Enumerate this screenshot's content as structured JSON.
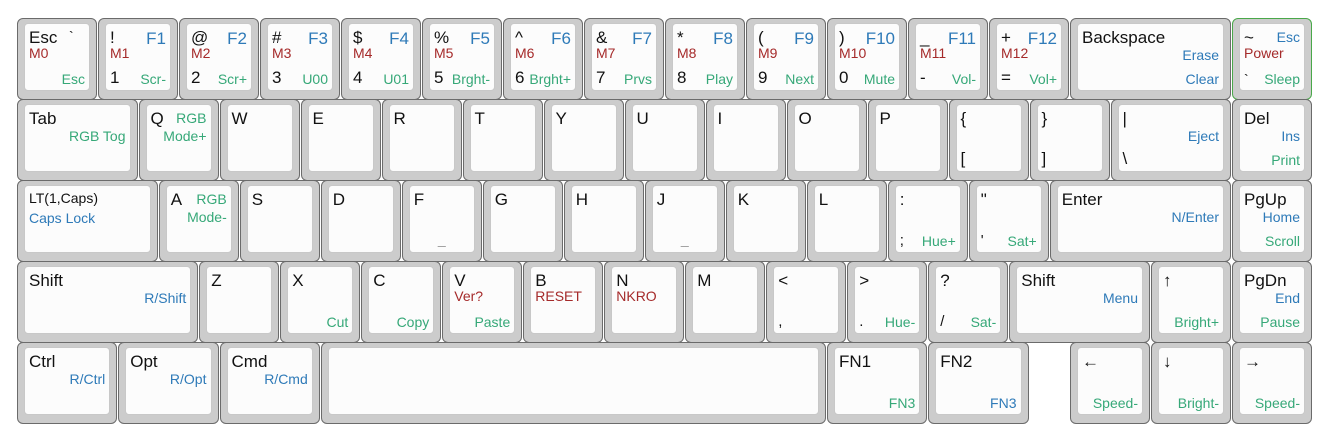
{
  "colors": {
    "background": "#ffffff",
    "key_frame": "#cccccc",
    "key_top": "#fcfcfc",
    "key_border": "#6b6b6b",
    "accent_border": "#4aa84a",
    "black": "#111111",
    "blue": "#2e7ab8",
    "red": "#a52a2a",
    "green": "#36a878"
  },
  "keys": {
    "esc": {
      "tl": "Esc",
      "tl_b": "`",
      "m": "M0",
      "br": "Esc"
    },
    "k1": {
      "tl": "!",
      "tr": "F1",
      "m": "M1",
      "bl": "1",
      "br": "Scr-"
    },
    "k2": {
      "tl": "@",
      "tr": "F2",
      "m": "M2",
      "bl": "2",
      "br": "Scr+"
    },
    "k3": {
      "tl": "#",
      "tr": "F3",
      "m": "M3",
      "bl": "3",
      "br": "U00"
    },
    "k4": {
      "tl": "$",
      "tr": "F4",
      "m": "M4",
      "bl": "4",
      "br": "U01"
    },
    "k5": {
      "tl": "%",
      "tr": "F5",
      "m": "M5",
      "bl": "5",
      "br": "Brght-"
    },
    "k6": {
      "tl": "^",
      "tr": "F6",
      "m": "M6",
      "bl": "6",
      "br": "Brght+"
    },
    "k7": {
      "tl": "&",
      "tr": "F7",
      "m": "M7",
      "bl": "7",
      "br": "Prvs"
    },
    "k8": {
      "tl": "*",
      "tr": "F8",
      "m": "M8",
      "bl": "8",
      "br": "Play"
    },
    "k9": {
      "tl": "(",
      "tr": "F9",
      "m": "M9",
      "bl": "9",
      "br": "Next"
    },
    "k0": {
      "tl": ")",
      "tr": "F10",
      "m": "M10",
      "bl": "0",
      "br": "Mute"
    },
    "minus": {
      "tl": "_",
      "tr": "F11",
      "m": "M11",
      "bl": "-",
      "br": "Vol-"
    },
    "equal": {
      "tl": "+",
      "tr": "F12",
      "m": "M12",
      "bl": "=",
      "br": "Vol+"
    },
    "backspace": {
      "tl": "Backspace",
      "mr": "Erase",
      "br": "Clear"
    },
    "tilde": {
      "tl": "~",
      "tr": "Esc",
      "m": "Power",
      "bl": "`",
      "br": "Sleep"
    },
    "tab": {
      "tl": "Tab",
      "mr": "RGB Tog"
    },
    "q": {
      "tl": "Q",
      "tr": "RGB",
      "mr": "Mode+"
    },
    "w": {
      "tl": "W"
    },
    "e": {
      "tl": "E"
    },
    "r": {
      "tl": "R"
    },
    "t": {
      "tl": "T"
    },
    "y": {
      "tl": "Y"
    },
    "u": {
      "tl": "U"
    },
    "i": {
      "tl": "I"
    },
    "o": {
      "tl": "O"
    },
    "p": {
      "tl": "P"
    },
    "lbracket": {
      "tl": "{",
      "bl": "["
    },
    "rbracket": {
      "tl": "}",
      "bl": "]"
    },
    "backslash": {
      "tl": "|",
      "mr": "Eject",
      "bl": "\\"
    },
    "del": {
      "tl": "Del",
      "mr": "Ins",
      "br": "Print"
    },
    "caps": {
      "tl": "LT(1,Caps)",
      "ml": "Caps Lock"
    },
    "a": {
      "tl": "A",
      "tr": "RGB",
      "mr": "Mode-"
    },
    "s": {
      "tl": "S"
    },
    "d": {
      "tl": "D"
    },
    "f": {
      "tl": "F",
      "bc": "_"
    },
    "g": {
      "tl": "G"
    },
    "h": {
      "tl": "H"
    },
    "j": {
      "tl": "J",
      "bc": "_"
    },
    "k": {
      "tl": "K"
    },
    "l": {
      "tl": "L"
    },
    "semicolon": {
      "tl": ":",
      "bl": ";",
      "br": "Hue+"
    },
    "quote": {
      "tl": "\"",
      "bl": "'",
      "br": "Sat+"
    },
    "enter": {
      "tl": "Enter",
      "mr": "N/Enter"
    },
    "pgup": {
      "tl": "PgUp",
      "mr": "Home",
      "br": "Scroll"
    },
    "lshift": {
      "tl": "Shift",
      "mr": "R/Shift"
    },
    "z": {
      "tl": "Z"
    },
    "x": {
      "tl": "X",
      "br": "Cut"
    },
    "c": {
      "tl": "C",
      "br": "Copy"
    },
    "v": {
      "tl": "V",
      "m": "Ver?",
      "br": "Paste"
    },
    "b": {
      "tl": "B",
      "m": "RESET"
    },
    "n": {
      "tl": "N",
      "m": "NKRO"
    },
    "m": {
      "tl": "M"
    },
    "comma": {
      "tl": "<",
      "bl": ","
    },
    "period": {
      "tl": ">",
      "bl": ".",
      "br": "Hue-"
    },
    "slash": {
      "tl": "?",
      "bl": "/",
      "br": "Sat-"
    },
    "rshift": {
      "tl": "Shift",
      "mr": "Menu"
    },
    "up": {
      "tl": "↑",
      "br": "Bright+"
    },
    "pgdn": {
      "tl": "PgDn",
      "mr": "End",
      "br": "Pause"
    },
    "ctrl": {
      "tl": "Ctrl",
      "mr": "R/Ctrl"
    },
    "opt": {
      "tl": "Opt",
      "mr": "R/Opt"
    },
    "cmd": {
      "tl": "Cmd",
      "mr": "R/Cmd"
    },
    "space": {},
    "fn1": {
      "tl": "FN1",
      "br": "FN3"
    },
    "fn2": {
      "tl": "FN2",
      "br": "FN3"
    },
    "left": {
      "tl": "←",
      "br": "Speed-"
    },
    "down": {
      "tl": "↓",
      "br": "Bright-"
    },
    "right": {
      "tl": "→",
      "br": "Speed-"
    }
  }
}
